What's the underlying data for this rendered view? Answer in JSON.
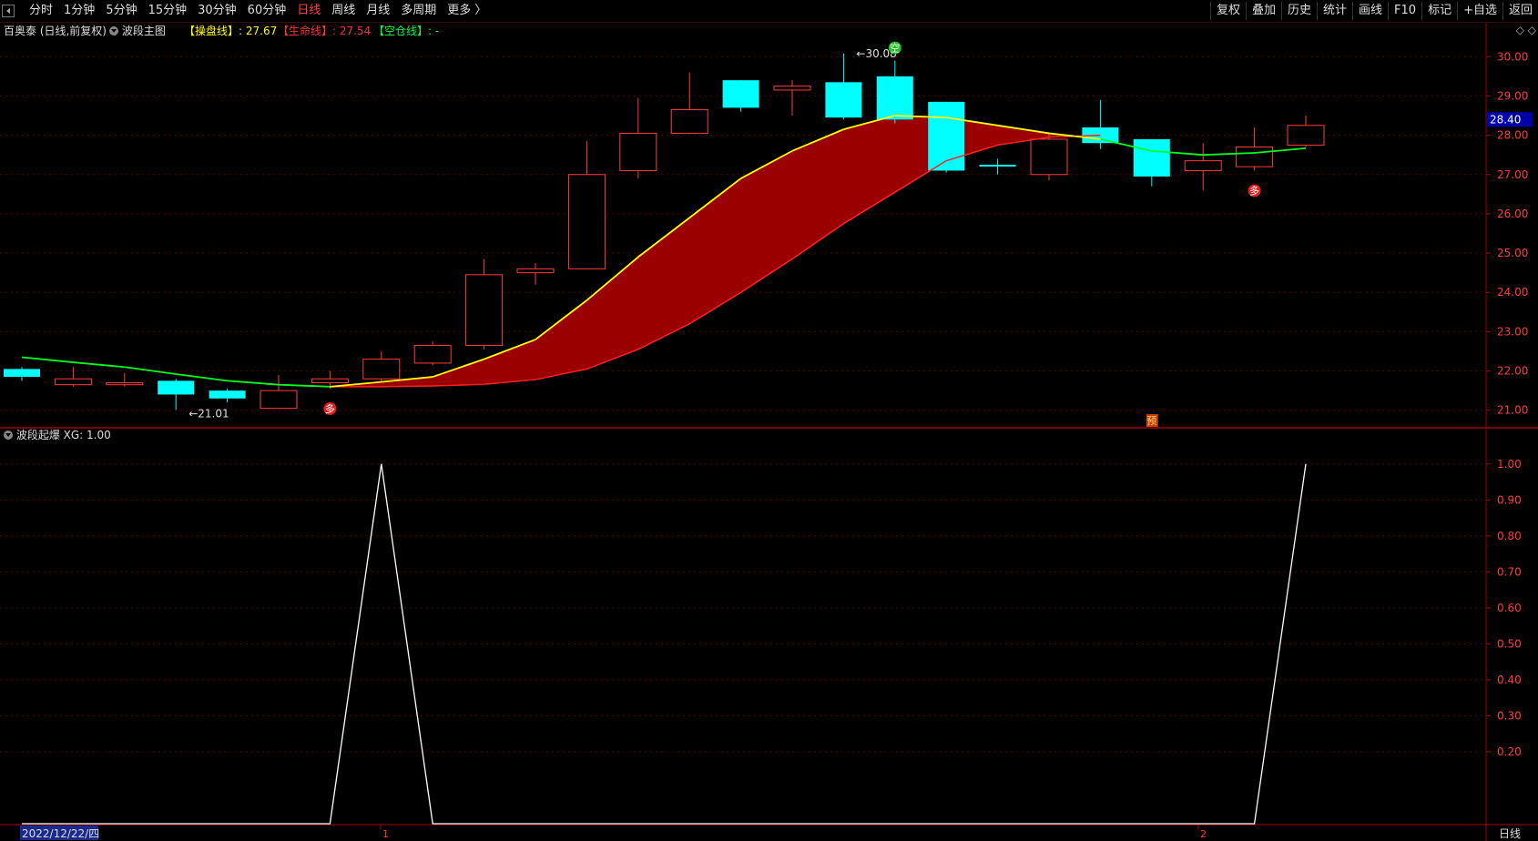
{
  "toolbar": {
    "tabs": [
      "分时",
      "1分钟",
      "5分钟",
      "15分钟",
      "30分钟",
      "60分钟",
      "日线",
      "周线",
      "月线",
      "多周期",
      "更多 〉"
    ],
    "active_tab": "日线",
    "right_tools": [
      "复权",
      "叠加",
      "历史",
      "统计",
      "画线",
      "F10",
      "标记",
      "+自选",
      "返回"
    ]
  },
  "info": {
    "stock": "百奥泰 (日线,前复权)",
    "indicator": "波段主图",
    "line1": "【操盘线】: 27.67",
    "line2": "【生命线】: 27.54",
    "line3": "【空仓线】: -",
    "colors": {
      "line1": "#ffff00",
      "line2": "#ff2020",
      "line3": "#00ff00"
    }
  },
  "subpanel": {
    "label": "波段起爆  XG: 1.00"
  },
  "bottom": {
    "date": "2022/12/22/四",
    "tick1": "1",
    "tick2": "2",
    "period": "日线"
  },
  "current_price": "28.40",
  "corner_icon": "◇ ◇",
  "chart_data": [
    {
      "type": "candlestick",
      "ylim": [
        20.6,
        30.4
      ],
      "yticks": [
        "30.00",
        "29.00",
        "28.00",
        "27.00",
        "26.00",
        "25.00",
        "24.00",
        "23.00",
        "22.00",
        "21.00"
      ],
      "ytick_values": [
        30,
        29,
        28,
        27,
        26,
        25,
        24,
        23,
        22,
        21
      ],
      "candles": [
        {
          "o": 22.05,
          "c": 21.85,
          "h": 22.1,
          "l": 21.75,
          "up": false
        },
        {
          "o": 21.65,
          "c": 21.8,
          "h": 22.1,
          "l": 21.6,
          "up": true
        },
        {
          "o": 21.65,
          "c": 21.7,
          "h": 21.95,
          "l": 21.6,
          "up": true
        },
        {
          "o": 21.75,
          "c": 21.4,
          "h": 21.8,
          "l": 21.01,
          "up": false
        },
        {
          "o": 21.5,
          "c": 21.3,
          "h": 21.55,
          "l": 21.2,
          "up": false
        },
        {
          "o": 21.05,
          "c": 21.5,
          "h": 21.9,
          "l": 21.05,
          "up": true
        },
        {
          "o": 21.7,
          "c": 21.8,
          "h": 22.0,
          "l": 21.55,
          "up": true
        },
        {
          "o": 21.8,
          "c": 22.3,
          "h": 22.5,
          "l": 21.7,
          "up": true
        },
        {
          "o": 22.2,
          "c": 22.65,
          "h": 22.75,
          "l": 22.15,
          "up": true
        },
        {
          "o": 22.65,
          "c": 24.45,
          "h": 24.85,
          "l": 22.55,
          "up": true
        },
        {
          "o": 24.5,
          "c": 24.6,
          "h": 24.75,
          "l": 24.2,
          "up": true
        },
        {
          "o": 24.6,
          "c": 27.0,
          "h": 27.85,
          "l": 24.6,
          "up": true
        },
        {
          "o": 27.1,
          "c": 28.05,
          "h": 28.95,
          "l": 26.9,
          "up": true
        },
        {
          "o": 28.05,
          "c": 28.65,
          "h": 29.6,
          "l": 28.05,
          "up": true
        },
        {
          "o": 29.4,
          "c": 28.7,
          "h": 29.4,
          "l": 28.6,
          "up": false
        },
        {
          "o": 29.15,
          "c": 29.25,
          "h": 29.4,
          "l": 28.5,
          "up": true
        },
        {
          "o": 29.35,
          "c": 28.45,
          "h": 30.08,
          "l": 28.4,
          "up": false
        },
        {
          "o": 29.5,
          "c": 28.4,
          "h": 29.9,
          "l": 28.3,
          "up": false
        },
        {
          "o": 28.85,
          "c": 27.1,
          "h": 28.85,
          "l": 27.05,
          "up": false
        },
        {
          "o": 27.25,
          "c": 27.25,
          "h": 27.4,
          "l": 27.0,
          "up": false
        },
        {
          "o": 27.0,
          "c": 27.9,
          "h": 28.05,
          "l": 26.85,
          "up": true
        },
        {
          "o": 28.2,
          "c": 27.8,
          "h": 28.9,
          "l": 27.65,
          "up": false
        },
        {
          "o": 27.9,
          "c": 26.95,
          "h": 27.9,
          "l": 26.7,
          "up": false
        },
        {
          "o": 27.1,
          "c": 27.35,
          "h": 27.8,
          "l": 26.6,
          "up": true
        },
        {
          "o": 27.2,
          "c": 27.7,
          "h": 28.2,
          "l": 27.1,
          "up": true
        },
        {
          "o": 27.75,
          "c": 28.25,
          "h": 28.5,
          "l": 27.7,
          "up": true
        }
      ],
      "operate_line": [
        22.35,
        22.22,
        22.1,
        21.92,
        21.75,
        21.65,
        21.6,
        21.72,
        21.85,
        22.3,
        22.8,
        23.8,
        24.9,
        25.9,
        26.9,
        27.6,
        28.15,
        28.5,
        28.45,
        28.25,
        28.05,
        27.9,
        27.6,
        27.5,
        27.55,
        27.67
      ],
      "life_line": [
        null,
        null,
        null,
        null,
        null,
        null,
        21.6,
        21.6,
        21.62,
        21.66,
        21.78,
        22.05,
        22.55,
        23.2,
        24.0,
        24.85,
        25.75,
        26.55,
        27.35,
        27.75,
        27.95,
        28.0,
        null,
        null,
        null,
        27.54
      ],
      "operate_color_segments": [
        "green",
        "green",
        "green",
        "green",
        "green",
        "green",
        "yellow",
        "yellow",
        "yellow",
        "yellow",
        "yellow",
        "yellow",
        "yellow",
        "yellow",
        "yellow",
        "yellow",
        "yellow",
        "yellow",
        "yellow",
        "yellow",
        "yellow",
        "green",
        "green",
        "green",
        "green",
        "yellow"
      ],
      "annotations": [
        {
          "text": "30.08",
          "index": 16,
          "value": 30.08
        },
        {
          "text": "21.01",
          "index": 3,
          "value": 21.01
        }
      ],
      "markers": [
        {
          "text": "多",
          "index": 6,
          "kind": "buy"
        },
        {
          "text": "空",
          "index": 17,
          "kind": "sell"
        },
        {
          "text": "多",
          "index": 24,
          "kind": "buy"
        },
        {
          "text": "预",
          "index": 22,
          "kind": "pre"
        }
      ]
    },
    {
      "type": "line",
      "ylim": [
        0,
        1.05
      ],
      "yticks": [
        "1.00",
        "0.90",
        "0.80",
        "0.70",
        "0.60",
        "0.50",
        "0.40",
        "0.30",
        "0.20"
      ],
      "ytick_values": [
        1.0,
        0.9,
        0.8,
        0.7,
        0.6,
        0.5,
        0.4,
        0.3,
        0.2
      ],
      "values": [
        0,
        0,
        0,
        0,
        0,
        0,
        0,
        1,
        0,
        0,
        0,
        0,
        0,
        0,
        0,
        0,
        0,
        0,
        0,
        0,
        0,
        0,
        0,
        0,
        0,
        1
      ]
    }
  ]
}
